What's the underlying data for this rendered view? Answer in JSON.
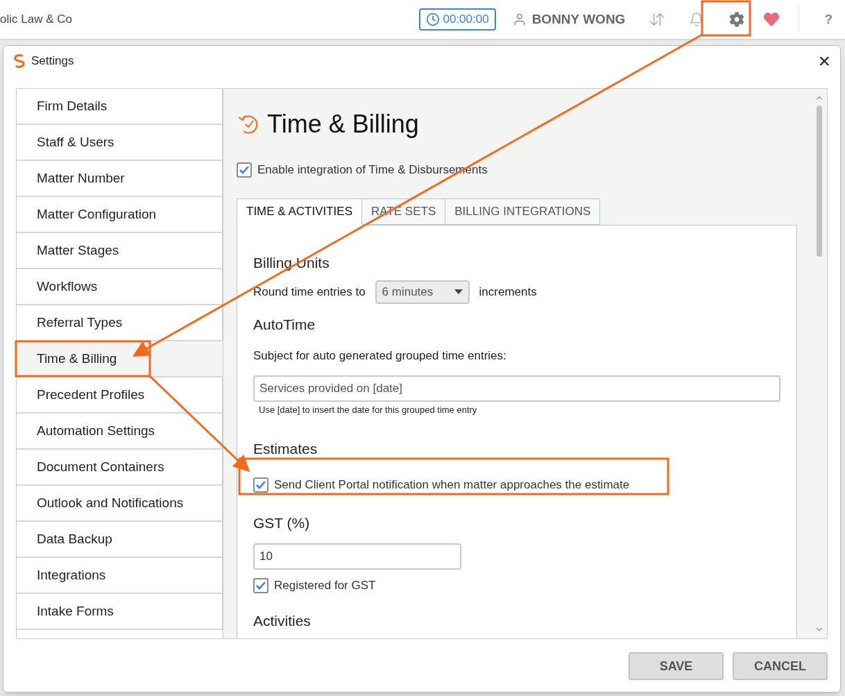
{
  "topbar": {
    "firm_name": "olic Law & Co",
    "timer": "00:00:00",
    "user": "BONNY WONG",
    "help": "?"
  },
  "dialog": {
    "title": "Settings",
    "close": "×",
    "nav": [
      {
        "label": "Firm Details",
        "selected": false
      },
      {
        "label": "Staff & Users",
        "selected": false
      },
      {
        "label": "Matter Number",
        "selected": false
      },
      {
        "label": "Matter Configuration",
        "selected": false
      },
      {
        "label": "Matter Stages",
        "selected": false
      },
      {
        "label": "Workflows",
        "selected": false
      },
      {
        "label": "Referral Types",
        "selected": false
      },
      {
        "label": "Time & Billing",
        "selected": true
      },
      {
        "label": "Precedent Profiles",
        "selected": false
      },
      {
        "label": "Automation Settings",
        "selected": false
      },
      {
        "label": "Document Containers",
        "selected": false
      },
      {
        "label": "Outlook and Notifications",
        "selected": false
      },
      {
        "label": "Data Backup",
        "selected": false
      },
      {
        "label": "Integrations",
        "selected": false
      },
      {
        "label": "Intake Forms",
        "selected": false
      }
    ],
    "page_title": "Time & Billing",
    "enable_integration": {
      "label": "Enable integration of Time & Disbursements",
      "checked": true
    },
    "tabs": [
      {
        "label": "TIME & ACTIVITIES",
        "selected": true
      },
      {
        "label": "RATE SETS",
        "selected": false
      },
      {
        "label": "BILLING INTEGRATIONS",
        "selected": false
      }
    ],
    "billing_units": {
      "heading": "Billing Units",
      "prefix": "Round time entries to",
      "value": "6 minutes",
      "suffix": "increments"
    },
    "autotime": {
      "heading": "AutoTime",
      "label": "Subject for auto generated grouped time entries:",
      "value": "Services provided on [date]",
      "hint": "Use [date] to insert the date for this grouped time entry"
    },
    "estimates": {
      "heading": "Estimates",
      "label": "Send Client Portal notification when matter approaches the estimate",
      "checked": true
    },
    "gst": {
      "heading": "GST (%)",
      "value": "10",
      "registered": {
        "label": "Registered for GST",
        "checked": true
      }
    },
    "activities": {
      "heading": "Activities"
    },
    "buttons": [
      "SAVE",
      "CANCEL"
    ]
  }
}
